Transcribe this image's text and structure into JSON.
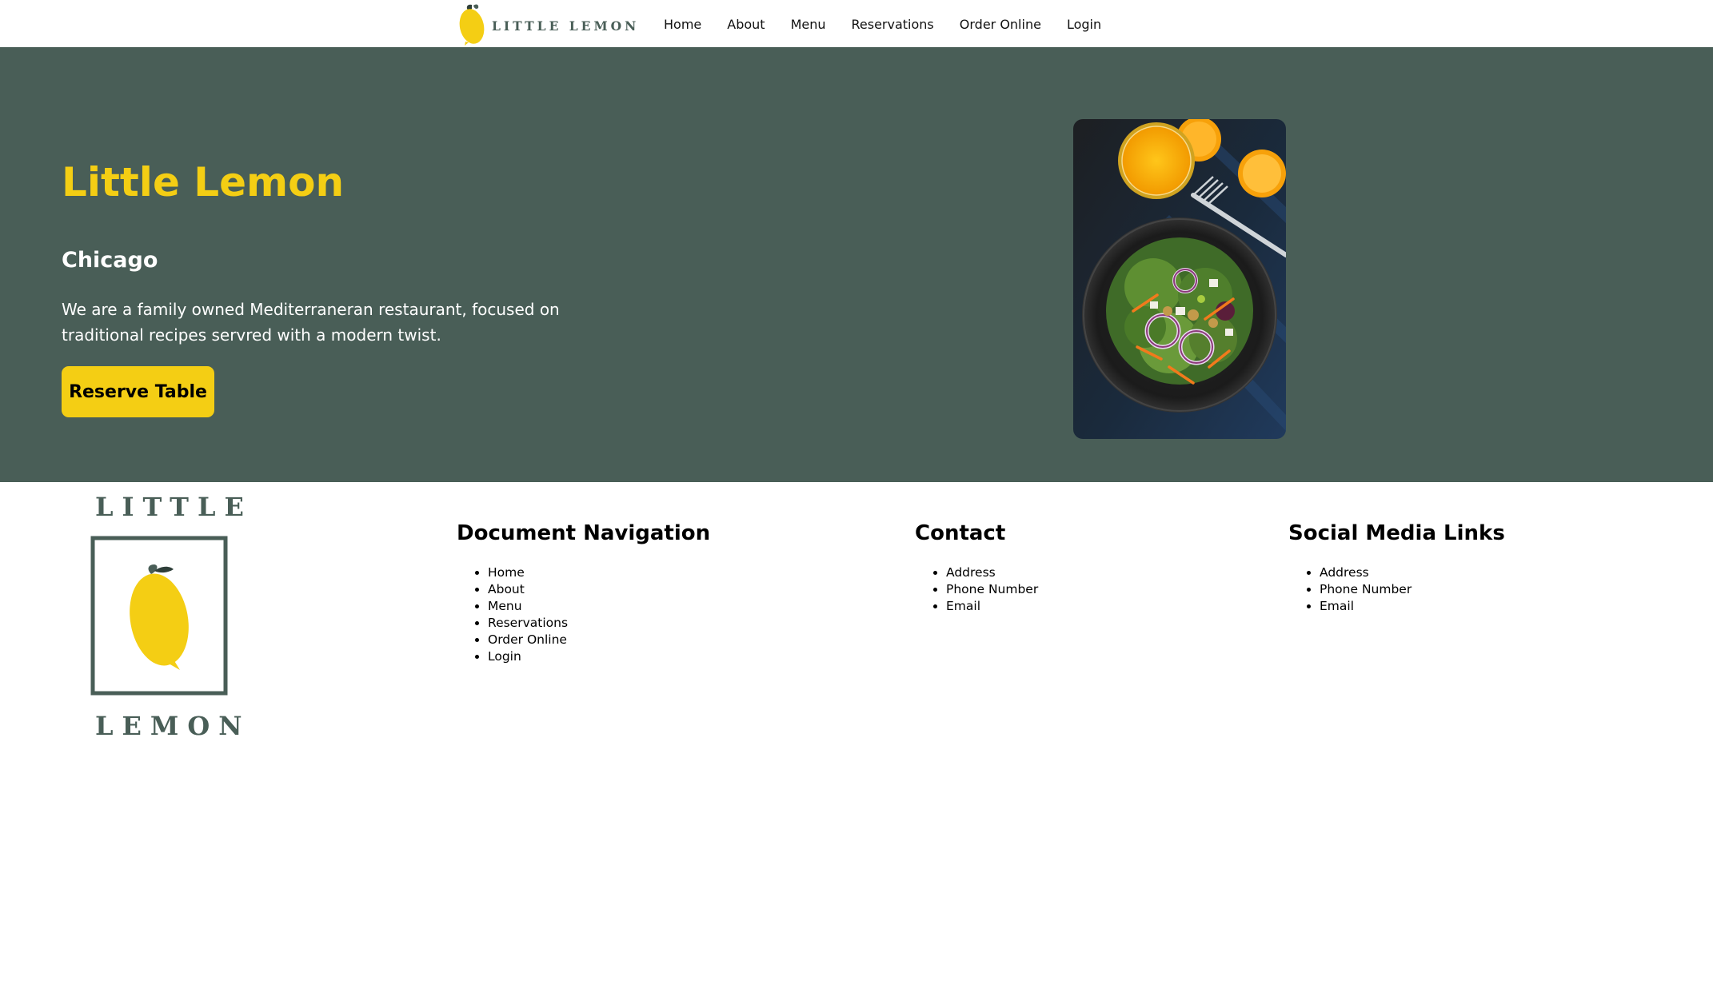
{
  "header": {
    "brand_text": "LITTLE LEMON",
    "nav": [
      {
        "label": "Home"
      },
      {
        "label": "About"
      },
      {
        "label": "Menu"
      },
      {
        "label": "Reservations"
      },
      {
        "label": "Order Online"
      },
      {
        "label": "Login"
      }
    ]
  },
  "hero": {
    "title": "Little Lemon",
    "city": "Chicago",
    "description": "We are a family owned Mediterraneran restaurant, focused on traditional recipes servred with a modern twist.",
    "button_label": "Reserve Table",
    "image_icon": "salad-and-orange-juice-photo"
  },
  "footer": {
    "logo": {
      "top_word": "LITTLE",
      "bottom_word": "LEMON"
    },
    "document_navigation": {
      "heading": "Document Navigation",
      "items": [
        "Home",
        "About",
        "Menu",
        "Reservations",
        "Order Online",
        "Login"
      ]
    },
    "contact": {
      "heading": "Contact",
      "items": [
        "Address",
        "Phone Number",
        "Email"
      ]
    },
    "social_media": {
      "heading": "Social Media Links",
      "items": [
        "Address",
        "Phone Number",
        "Email"
      ]
    }
  },
  "colors": {
    "primary_green": "#495e57",
    "primary_yellow": "#f4ce14",
    "white": "#ffffff",
    "black": "#000000"
  }
}
